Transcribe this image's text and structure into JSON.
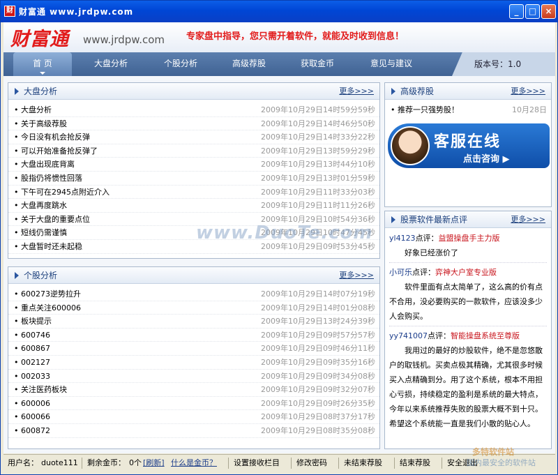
{
  "window": {
    "icon_char": "财",
    "title": "财富通 www.jrdpw.com",
    "min": "_",
    "max": "□",
    "close": "×"
  },
  "header": {
    "logo": "财富通",
    "url": "www.jrdpw.com",
    "slogan": "专家盘中指导，您只需开着软件，就能及时收到信息！"
  },
  "nav": {
    "items": [
      "首 页",
      "大盘分析",
      "个股分析",
      "高级荐股",
      "获取金币",
      "意见与建议"
    ],
    "version": "版本号：1.0"
  },
  "market": {
    "title": "大盘分析",
    "more": "更多>>>",
    "rows": [
      {
        "t": "• 大盘分析",
        "d": "2009年10月29日14时59分59秒"
      },
      {
        "t": "• 关于高级荐股",
        "d": "2009年10月29日14时46分50秒"
      },
      {
        "t": "• 今日没有机会抢反弹",
        "d": "2009年10月29日14时33分22秒"
      },
      {
        "t": "• 可以开始准备抢反弹了",
        "d": "2009年10月29日13时59分29秒"
      },
      {
        "t": "• 大盘出现底背离",
        "d": "2009年10月29日13时44分10秒"
      },
      {
        "t": "• 股指仍将惯性回落",
        "d": "2009年10月29日13时01分59秒"
      },
      {
        "t": "• 下午可在2945点附近介入",
        "d": "2009年10月29日11时33分03秒"
      },
      {
        "t": "• 大盘再度跳水",
        "d": "2009年10月29日11时11分26秒"
      },
      {
        "t": "• 关于大盘的重要点位",
        "d": "2009年10月29日10时54分36秒"
      },
      {
        "t": "• 短线仍需谨慎",
        "d": "2009年10月29日10时47分45秒"
      },
      {
        "t": "• 大盘暂时还未起稳",
        "d": "2009年10月29日09时53分45秒"
      }
    ]
  },
  "stocks": {
    "title": "个股分析",
    "more": "更多>>>",
    "rows": [
      {
        "t": "• 600273逆势拉升",
        "d": "2009年10月29日14时07分19秒"
      },
      {
        "t": "• 重点关注600006",
        "d": "2009年10月29日14时01分08秒"
      },
      {
        "t": "• 板块提示",
        "d": "2009年10月29日13时24分39秒"
      },
      {
        "t": "• 600746",
        "d": "2009年10月29日09时57分57秒"
      },
      {
        "t": "• 600867",
        "d": "2009年10月29日09时46分11秒"
      },
      {
        "t": "• 002127",
        "d": "2009年10月29日09时35分16秒"
      },
      {
        "t": "• 002033",
        "d": "2009年10月29日09时34分08秒"
      },
      {
        "t": "• 关注医药板块",
        "d": "2009年10月29日09时32分07秒"
      },
      {
        "t": "• 600006",
        "d": "2009年10月29日09时26分35秒"
      },
      {
        "t": "• 600066",
        "d": "2009年10月29日08时37分17秒"
      },
      {
        "t": "• 600872",
        "d": "2009年10月29日08时35分08秒"
      }
    ]
  },
  "recommend": {
    "title": "高级荐股",
    "more": "更多>>>",
    "rows": [
      {
        "t": "• 推荐一只强势股！",
        "d": "10月28日"
      }
    ],
    "cs_line1": "客服在线",
    "cs_line2": "点击咨询 ▶"
  },
  "reviews": {
    "title": "股票软件最新点评",
    "more": "更多>>>",
    "items": [
      {
        "user": "yl4123",
        "label": "点评：",
        "software": "益盟操盘手主力版",
        "text": "好象已经涨价了"
      },
      {
        "user": "小可乐",
        "label": "点评：",
        "software": "弈神大户室专业版",
        "text": "软件里面有点太简单了，这么高的价有点不合用，没必要购买的一款软件，应该没多少人会购买。"
      },
      {
        "user": "yy741007",
        "label": "点评：",
        "software": "智能操盘系统至尊版",
        "text": "我用过的最好的炒股软件，绝不是忽悠散户的取钱机。买卖点极其精确，尤其很多时候买入点精确到分。用了这个系统，根本不用担心亏损，持续稳定的盈利是系统的最大特点，今年以来系统推荐失败的股票大概不到十只。希望这个系统能一直是我们小散的贴心人。"
      }
    ]
  },
  "status": {
    "username_label": "用户名：",
    "username": "duote111",
    "coins_label": "剩余金币：",
    "coins": "0个",
    "refresh": "[刷新]",
    "what_coin": "什么是金币？",
    "settings": "设置接收栏目",
    "change_pwd": "修改密码",
    "unended": "未结束荐股",
    "ended": "结束荐股",
    "logout": "安全退出"
  },
  "watermarks": {
    "center": "www.DuoTe.com",
    "corner_brand": "多特软件站",
    "corner_sub": "国内最安全的软件站"
  }
}
